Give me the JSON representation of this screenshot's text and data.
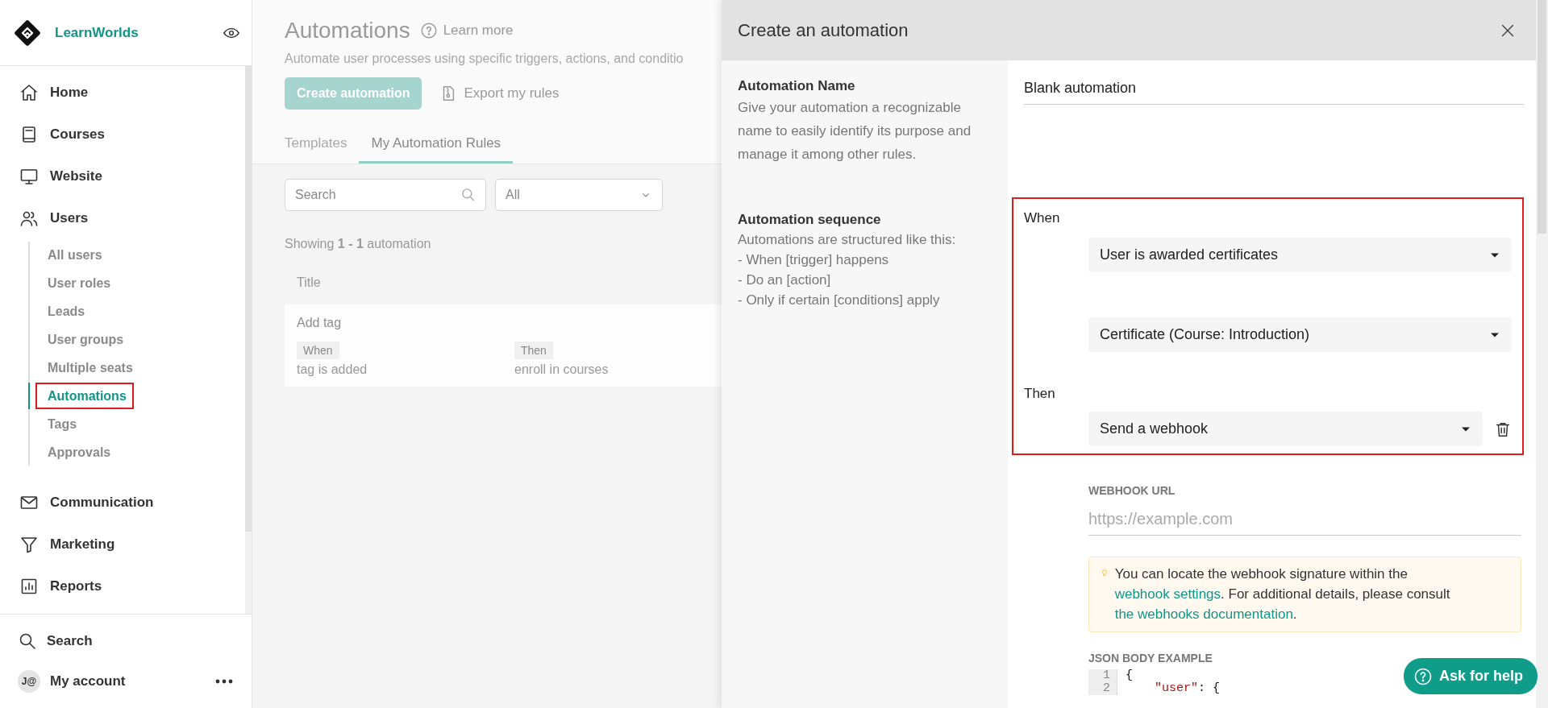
{
  "sidebar": {
    "brand": "LearnWorlds",
    "items": [
      {
        "label": "Home",
        "selected": false
      },
      {
        "label": "Courses",
        "selected": false
      },
      {
        "label": "Website",
        "selected": false
      },
      {
        "label": "Users",
        "selected": false,
        "expanded": true,
        "children": [
          {
            "label": "All users",
            "selected": false,
            "highlighted": false
          },
          {
            "label": "User roles",
            "selected": false,
            "highlighted": false
          },
          {
            "label": "Leads",
            "selected": false,
            "highlighted": false
          },
          {
            "label": "User groups",
            "selected": false,
            "highlighted": false
          },
          {
            "label": "Multiple seats",
            "selected": false,
            "highlighted": false
          },
          {
            "label": "Automations",
            "selected": true,
            "highlighted": true
          },
          {
            "label": "Tags",
            "selected": false,
            "highlighted": false
          },
          {
            "label": "Approvals",
            "selected": false,
            "highlighted": false
          }
        ]
      },
      {
        "label": "Communication",
        "selected": false
      },
      {
        "label": "Marketing",
        "selected": false
      },
      {
        "label": "Reports",
        "selected": false
      }
    ],
    "footer": [
      {
        "kind": "search",
        "label": "Search"
      },
      {
        "kind": "account",
        "label": "My account",
        "avatar": "J@"
      }
    ]
  },
  "main": {
    "title": "Automations",
    "learn_more": "Learn more",
    "subtitle": "Automate user processes using specific triggers, actions, and conditio",
    "create_button": "Create automation",
    "export_button": "Export my rules",
    "tabs": [
      {
        "label": "Templates",
        "selected": false
      },
      {
        "label": "My Automation Rules",
        "selected": true
      }
    ],
    "search": {
      "placeholder": "Search"
    },
    "filter": {
      "value": "All"
    },
    "count": "Showing **1 - 1** automation",
    "table": {
      "columns": [
        "Title"
      ],
      "rows": [
        {
          "title": "Add tag",
          "when_label": "When",
          "when": "tag is added",
          "then_label": "Then",
          "then": "enroll in courses"
        }
      ]
    }
  },
  "panel": {
    "title": "Create an automation",
    "name_section": {
      "heading": "Automation Name",
      "description": "Give your automation a recognizable name to easily identify its purpose and manage it among other rules.",
      "value": "Blank automation"
    },
    "sequence_section": {
      "heading": "Automation sequence",
      "description_lines": [
        "Automations are structured like this:",
        "- When [trigger] happens",
        "- Do an [action]",
        "- Only if certain [conditions] apply"
      ],
      "highlighted": true,
      "when_label": "When",
      "triggers": [
        "User is awarded certificates",
        "Certificate (Course: Introduction)"
      ],
      "then_label": "Then",
      "action": "Send a webhook"
    },
    "webhook": {
      "label": "WEBHOOK URL",
      "placeholder": "https://example.com",
      "tip": [
        {
          "text": "You can locate the webhook signature within the ",
          "link": false
        },
        {
          "text": "webhook settings",
          "link": true
        },
        {
          "text": ". For additional details, please consult ",
          "link": false
        },
        {
          "text": "the webhooks documentation",
          "link": true
        },
        {
          "text": ".",
          "link": false
        }
      ],
      "json_label": "JSON BODY EXAMPLE",
      "code": [
        {
          "number": "1",
          "indented": false,
          "tokens": [
            {
              "text": "{",
              "kind": "punct"
            }
          ]
        },
        {
          "number": "2",
          "indented": true,
          "tokens": [
            {
              "text": "\"user\"",
              "kind": "key"
            },
            {
              "text": ": {",
              "kind": "punct"
            }
          ]
        }
      ]
    }
  },
  "help": {
    "label": "Ask for help"
  }
}
